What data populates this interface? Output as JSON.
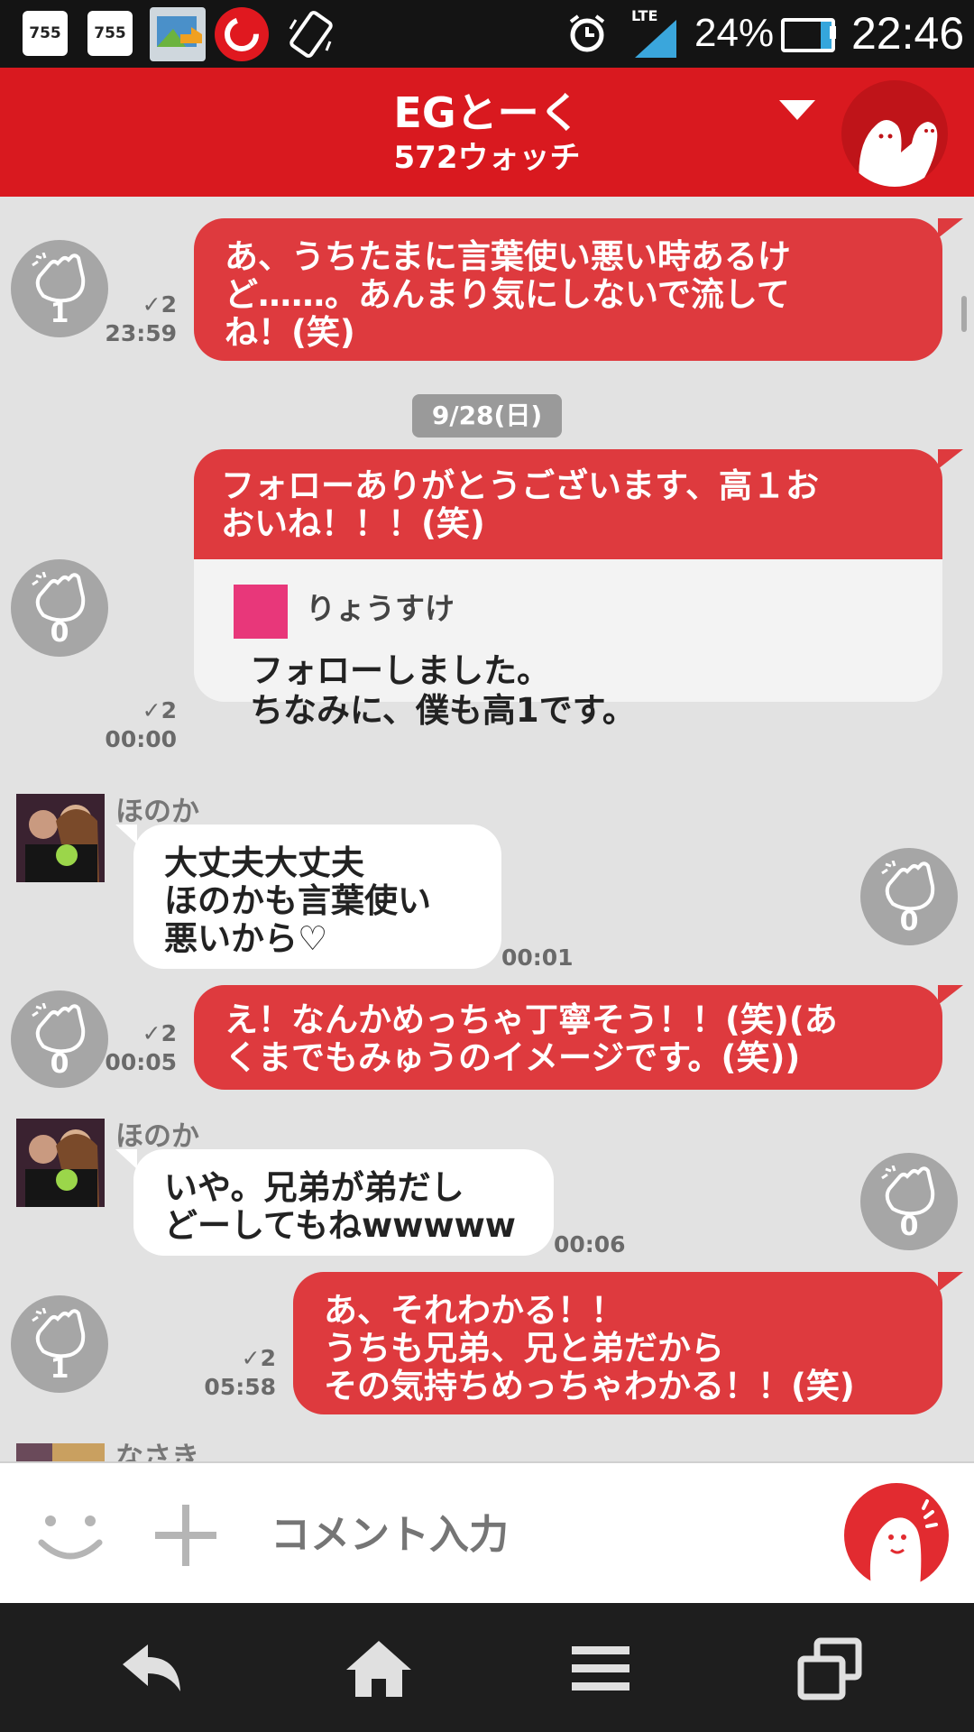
{
  "status_bar": {
    "app_icon_1": "755",
    "app_icon_2": "755",
    "network": "LTE",
    "battery_percent": "24%",
    "battery_level": 0.24,
    "time": "22:46",
    "icons": [
      "755-app-icon",
      "755-app-icon",
      "gallery-icon",
      "trend-micro-icon",
      "rotate-icon",
      "alarm-icon",
      "signal-icon",
      "battery-icon"
    ]
  },
  "header": {
    "title": "EGとーく",
    "subtitle": "572ウォッチ",
    "background": "#d9191f"
  },
  "messages": [
    {
      "type": "outgoing",
      "text": "あ、うちたまに言葉使い悪い時あるけ\nど……。あんまり気にしないで流して\nね！(笑)",
      "read": "✓2",
      "time": "23:59",
      "claps": "1"
    },
    {
      "type": "date",
      "text": "9/28(日)"
    },
    {
      "type": "outgoing",
      "text": "フォローありがとうございます、高１お\nおいね！！！(笑)",
      "quote_name": "りょうすけ",
      "quote_text": "フォローしました。\nちなみに、僕も高1です。",
      "read": "✓2",
      "time": "00:00",
      "claps": "0"
    },
    {
      "type": "incoming",
      "sender": "ほのか",
      "text": "大丈夫大丈夫\nほのかも言葉使い\n悪いから♡",
      "time": "00:01",
      "claps": "0"
    },
    {
      "type": "outgoing",
      "text": "え！なんかめっちゃ丁寧そう！！(笑)(あ\nくまでもみゅうのイメージです。(笑))",
      "read": "✓2",
      "time": "00:05",
      "claps": "0"
    },
    {
      "type": "incoming",
      "sender": "ほのか",
      "text": "いや。兄弟が弟だし\nどーしてもねwwwww",
      "time": "00:06",
      "claps": "0"
    },
    {
      "type": "outgoing",
      "text": "あ、それわかる！！\nうちも兄弟、兄と弟だから\nその気持ちめっちゃわかる！！(笑)",
      "read": "✓2",
      "time": "05:58",
      "claps": "1"
    },
    {
      "type": "incoming",
      "sender": "なさき"
    }
  ],
  "input": {
    "placeholder": "コメント入力"
  },
  "colors": {
    "accent": "#d9191f",
    "bubble_out": "#de3a3e",
    "chat_bg": "#e2e2e2",
    "clap_bg": "#a6a6a6"
  }
}
